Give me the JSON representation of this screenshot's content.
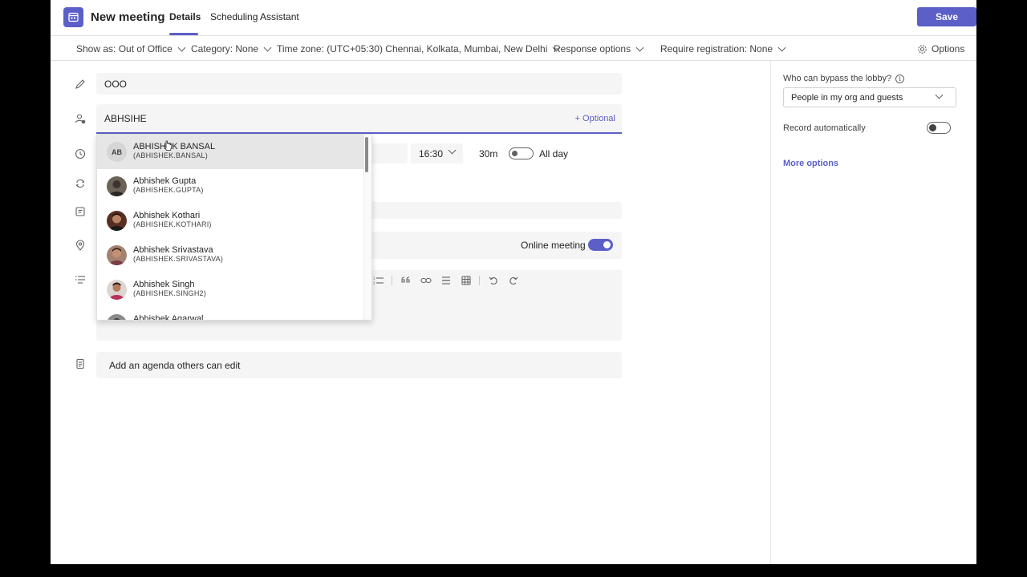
{
  "header": {
    "title": "New meeting",
    "tabs": [
      {
        "label": "Details",
        "active": true
      },
      {
        "label": "Scheduling Assistant",
        "active": false
      }
    ],
    "save_label": "Save"
  },
  "options_bar": {
    "show_as": "Show as: Out of Office",
    "category": "Category: None",
    "time_zone_label": "Time zone:",
    "time_zone_value": "(UTC+05:30) Chennai, Kolkata, Mumbai, New Delhi",
    "response_options": "Response options",
    "require_registration": "Require registration: None",
    "options": "Options"
  },
  "form": {
    "title_value": "OOO",
    "attendees_value": "ABHSIHE",
    "optional_label": "+ Optional",
    "end_time": "16:30",
    "duration": "30m",
    "all_day_label": "All day",
    "all_day_on": false,
    "online_meeting_label": "Online meeting",
    "online_meeting_on": true,
    "agenda_placeholder": "Add an agenda others can edit"
  },
  "suggestions": [
    {
      "name": "ABHISHEK BANSAL",
      "alias": "(ABHISHEK.BANSAL)",
      "initials": "AB",
      "hovered": true
    },
    {
      "name": "Abhishek Gupta",
      "alias": "(ABHISHEK.GUPTA)",
      "initials": "",
      "hovered": false
    },
    {
      "name": "Abhishek Kothari",
      "alias": "(ABHISHEK.KOTHARI)",
      "initials": "",
      "hovered": false
    },
    {
      "name": "Abhishek Srivastava",
      "alias": "(ABHISHEK.SRIVASTAVA)",
      "initials": "",
      "hovered": false
    },
    {
      "name": "Abhishek Singh",
      "alias": "(ABHISHEK.SINGH2)",
      "initials": "",
      "hovered": false
    },
    {
      "name": "Abhishek Agarwal",
      "alias": "",
      "initials": "",
      "hovered": false
    }
  ],
  "side_panel": {
    "lobby_label": "Who can bypass the lobby?",
    "lobby_value": "People in my org and guests",
    "record_label": "Record automatically",
    "record_on": false,
    "more_options": "More options"
  },
  "colors": {
    "accent": "#5b5fc7",
    "field_bg": "#f5f5f5"
  }
}
